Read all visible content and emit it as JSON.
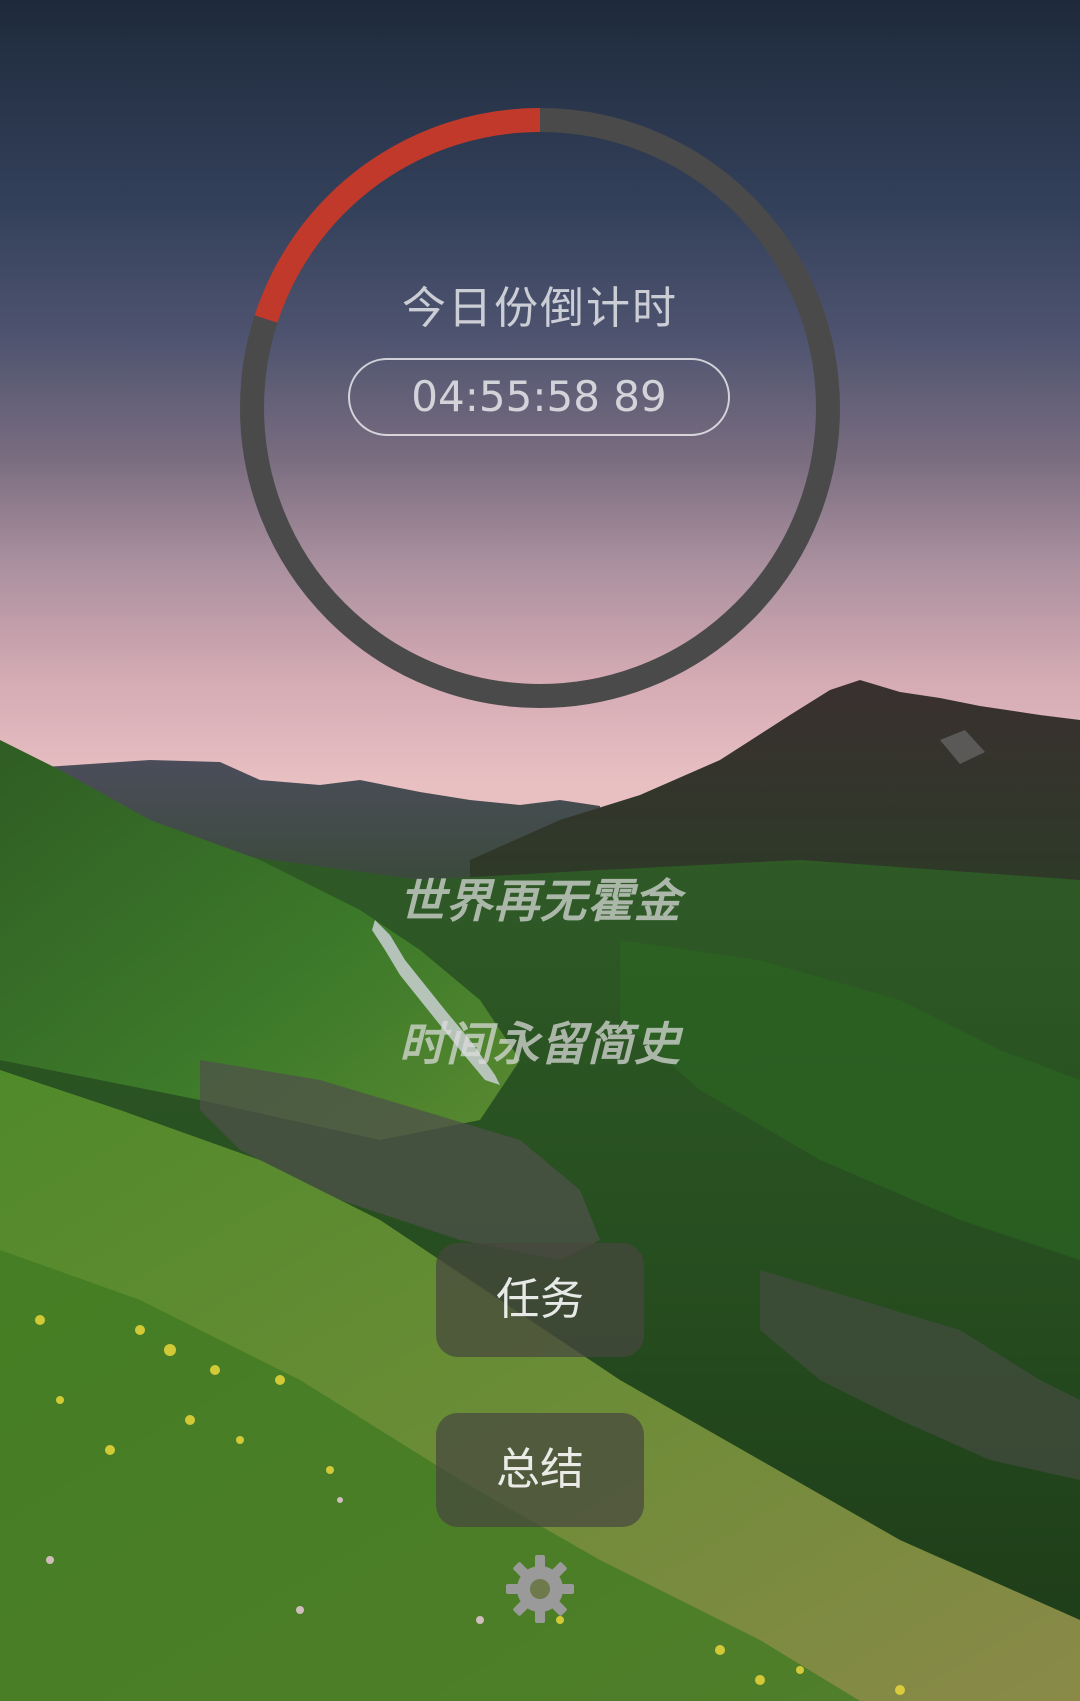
{
  "countdown": {
    "title": "今日份倒计时",
    "time": "04:55:58 89",
    "progress": 0.2
  },
  "quotes": {
    "line1": "世界再无霍金",
    "line2": "时间永留简史"
  },
  "buttons": {
    "tasks_label": "任务",
    "summary_label": "总结"
  },
  "icons": {
    "settings": "gear-icon"
  },
  "colors": {
    "ring_progress": "#c0392b",
    "ring_track": "#4a4a4a"
  }
}
